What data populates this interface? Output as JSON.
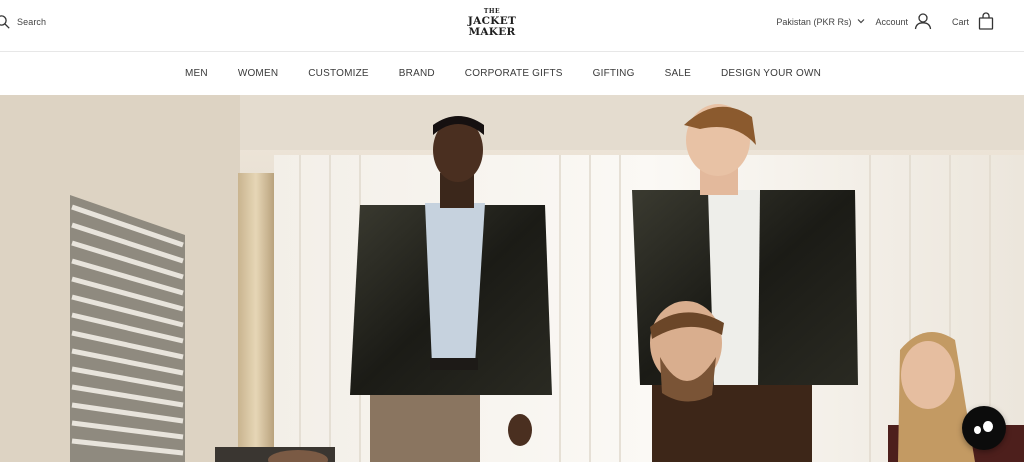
{
  "header": {
    "search_label": "Search",
    "logo": {
      "line1": "THE",
      "line2": "JACKET",
      "line3": "MAKER"
    },
    "country_selector": "Pakistan (PKR Rs)",
    "account_label": "Account",
    "cart_label": "Cart"
  },
  "nav": {
    "items": [
      "MEN",
      "WOMEN",
      "CUSTOMIZE",
      "BRAND",
      "CORPORATE GIFTS",
      "GIFTING",
      "SALE",
      "DESIGN YOUR OWN"
    ]
  },
  "hero": {
    "image_subject": "models-in-leather-jackets"
  },
  "icons": {
    "search": "search-icon",
    "country_dropdown": "chevron-down-icon",
    "account": "user-icon",
    "cart": "shopping-bag-icon",
    "chat": "chat-widget-icon"
  },
  "colors": {
    "text": "#2b2b2b",
    "nav_text": "#3a3a3a",
    "chat_bubble": "#0c0c0c",
    "divider": "#e7e7e7"
  }
}
